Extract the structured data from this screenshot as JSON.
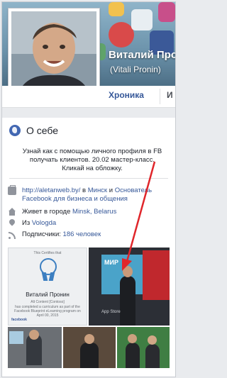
{
  "profile": {
    "name": "Виталий Пронин",
    "name_latin": "(Vitali Pronin)"
  },
  "tabs": [
    {
      "label": "Хроника",
      "active": true
    },
    {
      "label": "И",
      "active": false
    }
  ],
  "about": {
    "title": "О себе",
    "intro": "Узнай как с помощью личного профиля в FB получать клиентов. 20.02 мастер-класс. Кликай на обложку.",
    "work": {
      "link": "http://aletanweb.by/",
      "in": " в ",
      "place": "Минск",
      "and": " и ",
      "role": "Основатель Facebook для бизнеса и общения"
    },
    "lives_prefix": "Живет в городе ",
    "lives_city": "Minsk, Belarus",
    "from_prefix": "Из ",
    "from_city": "Vologda",
    "followers_prefix": "Подписчики: ",
    "followers_count": "186 человек"
  },
  "certificate": {
    "line1": "This Certifies that",
    "name": "Виталий Пронин",
    "line2": "Alt Content [Contoso]",
    "line3": "has completed a curriculum as part of the",
    "line4": "Facebook Blueprint eLearning program on",
    "date": "April 00, 2015",
    "brand": "facebook"
  },
  "photo2": {
    "screen_text": "МИР",
    "store_text": "App Store"
  },
  "colors": {
    "link": "#365899",
    "accent": "#4267b2",
    "arrow": "#e0262b"
  }
}
